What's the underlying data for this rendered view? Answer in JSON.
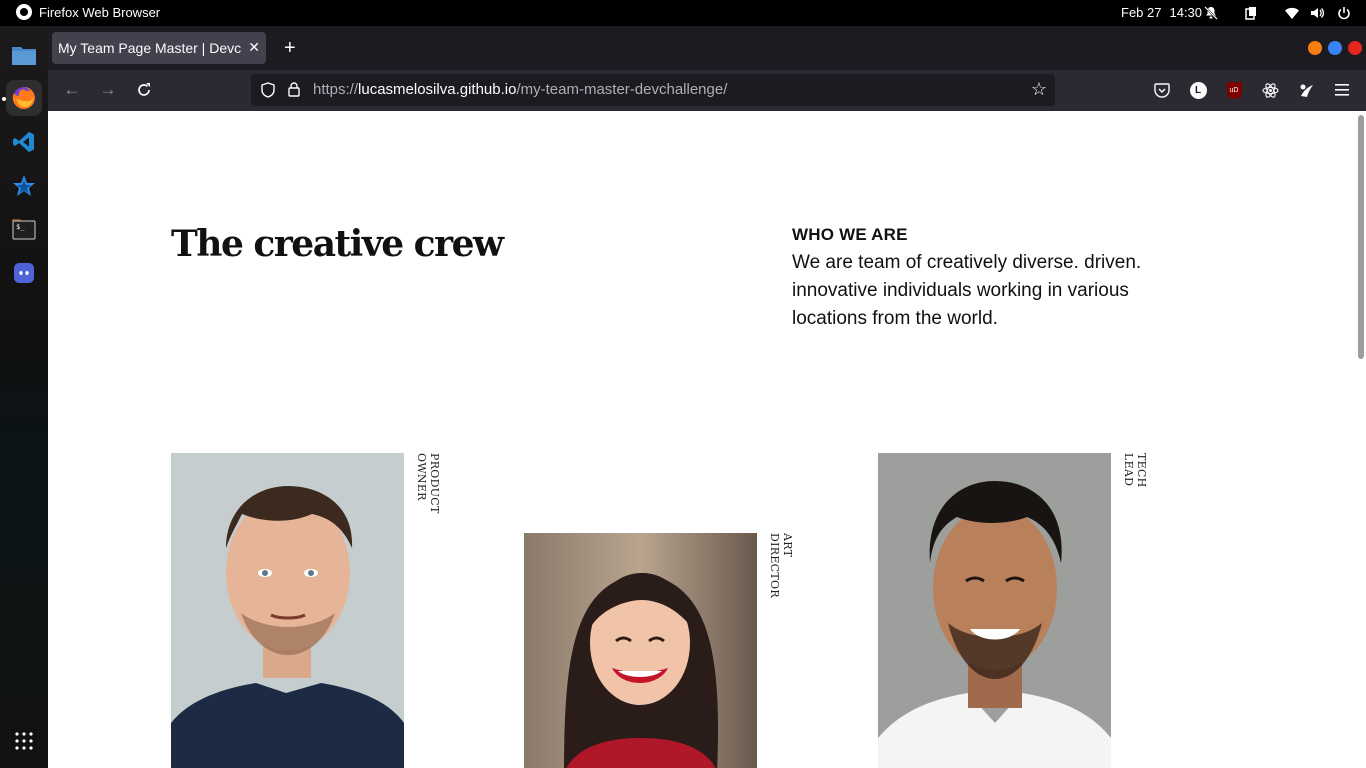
{
  "system": {
    "app_name": "Firefox Web Browser",
    "date": "Feb 27",
    "time": "14:30"
  },
  "browser": {
    "tab_title": "My Team Page Master | Devc",
    "url_scheme": "https://",
    "url_host": "lucasmelosilva.github.io",
    "url_path": "/my-team-master-devchallenge/",
    "account_initial": "L",
    "ublock_label": "uD"
  },
  "page": {
    "headline": "The creative crew",
    "who_heading": "WHO WE ARE",
    "who_text": "We are team of creatively diverse. driven. innovative individuals working in various locations from the world.",
    "members": [
      {
        "role": "PRODUCT OWNER"
      },
      {
        "role": "ART DIRECTOR"
      },
      {
        "role": "TECH LEAD"
      }
    ]
  },
  "colors": {
    "window_close": "#e5261f",
    "window_max": "#3b82f6",
    "window_min": "#f97d10"
  }
}
